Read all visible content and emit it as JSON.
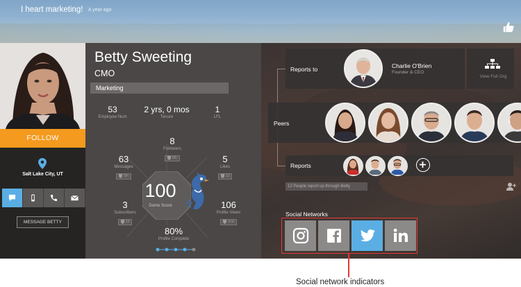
{
  "banner": {
    "status_text": "I heart marketing!",
    "status_time": "A year ago",
    "like_icon": "thumbs-up-icon"
  },
  "profile": {
    "follow_label": "FOLLOW",
    "location": "Salt Lake City, UT",
    "contact_icons": [
      "chat-icon",
      "mobile-phone-icon",
      "phone-icon",
      "email-icon"
    ],
    "message_label": "MESSAGE BETTY",
    "accent_color": "#f39a1f",
    "active_color": "#5aaee4"
  },
  "stats": {
    "name": "Betty Sweeting",
    "title": "CMO",
    "department": "Marketing",
    "employee_num": {
      "value": "53",
      "label": "Employee Num"
    },
    "tenure": {
      "value": "2 yrs, 0 mos",
      "label": "Tenure"
    },
    "lfl": {
      "value": "1",
      "label": "LFL"
    },
    "followers": {
      "value": "8",
      "label": "Followers",
      "badge": "8th"
    },
    "messages": {
      "value": "63",
      "label": "Messages",
      "badge": "9th"
    },
    "likes": {
      "value": "5",
      "label": "Likes",
      "badge": "13"
    },
    "subscribers": {
      "value": "3",
      "label": "Subscribers",
      "badge": "28"
    },
    "profile_views": {
      "value": "106",
      "label": "Profile Views",
      "badge": "2nd"
    },
    "domo_score": {
      "value": "100",
      "label": "Domo Score"
    },
    "profile_complete": {
      "value": "80%",
      "label": "Profile Complete",
      "fraction": 0.8
    }
  },
  "org": {
    "reports_to_label": "Reports to",
    "manager_name": "Charlie O'Brien",
    "manager_title": "Founder & CEO",
    "view_org_label": "View Full Org",
    "peers_label": "Peers",
    "reports_label": "Reports",
    "reports_note": "12 People report up through Betty",
    "social_title": "Social Networks",
    "social_networks": [
      "instagram-icon",
      "facebook-icon",
      "twitter-icon",
      "linkedin-icon"
    ],
    "active_network": "twitter-icon"
  },
  "callout": {
    "text": "Social network indicators",
    "color": "#e53935"
  }
}
